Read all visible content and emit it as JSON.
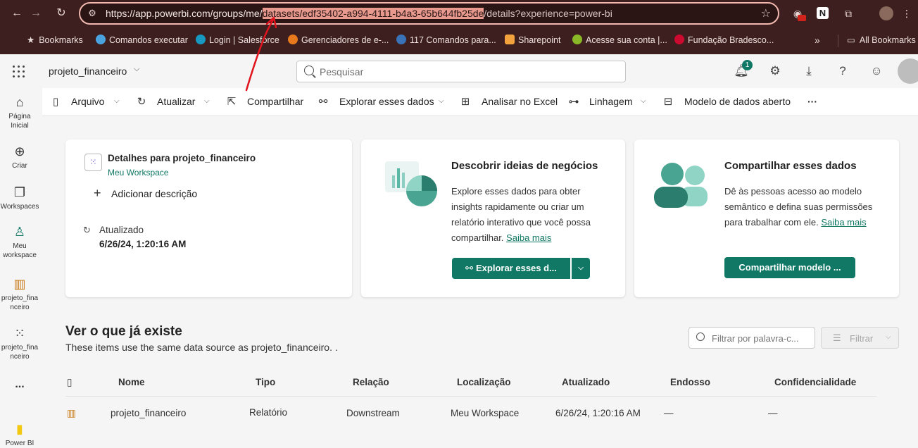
{
  "browser": {
    "url_prefix": "https://app.powerbi.com/groups/me/",
    "url_highlight": "datasets/edf35402-a994-4111-b4a3-65b644fb25de",
    "url_suffix": "/details?experience=power-bi",
    "bookmarks": [
      {
        "label": "Bookmarks",
        "icon": "star-icon",
        "color": "#d9c7c5"
      },
      {
        "label": "Comandos executar",
        "icon": "refresh-icon",
        "color": "#4aa3df"
      },
      {
        "label": "Login | Salesforce",
        "icon": "cloud-icon",
        "color": "#1798c1"
      },
      {
        "label": "Gerenciadores de e-...",
        "icon": "firefox-icon",
        "color": "#e8791c"
      },
      {
        "label": "117 Comandos para...",
        "icon": "globe-icon",
        "color": "#3b73b9"
      },
      {
        "label": "Sharepoint",
        "icon": "grid-icon",
        "color": "#f2a33c"
      },
      {
        "label": "Acesse sua conta |...",
        "icon": "dollar-icon",
        "color": "#8ab826"
      },
      {
        "label": "Fundação Bradesco...",
        "icon": "bradesco-icon",
        "color": "#cc092f"
      }
    ],
    "all_bookmarks": "All Bookmarks"
  },
  "header": {
    "workspace": "projeto_financeiro",
    "search_placeholder": "Pesquisar",
    "notification_count": "1"
  },
  "leftnav": [
    {
      "label1": "Página",
      "label2": "Inicial",
      "icon": "home-icon"
    },
    {
      "label1": "Criar",
      "label2": "",
      "icon": "create-icon"
    },
    {
      "label1": "Workspaces",
      "label2": "",
      "icon": "workspaces-icon"
    },
    {
      "label1": "Meu",
      "label2": "workspace",
      "icon": "my-workspace-icon"
    },
    {
      "label1": "projeto_fina",
      "label2": "nceiro",
      "icon": "report-icon"
    },
    {
      "label1": "projeto_fina",
      "label2": "nceiro",
      "icon": "semantic-model-icon"
    },
    {
      "label1": "...",
      "label2": "",
      "icon": "more-icon"
    },
    {
      "label1": "Power BI",
      "label2": "",
      "icon": "powerbi-logo-icon"
    }
  ],
  "toolbar": {
    "arquivo": "Arquivo",
    "atualizar": "Atualizar",
    "compartilhar": "Compartilhar",
    "explorar": "Explorar esses dados",
    "analisar": "Analisar no Excel",
    "linhagem": "Linhagem",
    "modelo": "Modelo de dados aberto",
    "more": "···"
  },
  "details_card": {
    "title": "Detalhes para projeto_financeiro",
    "workspace": "Meu Workspace",
    "add_description": "Adicionar descrição",
    "updated_label": "Atualizado",
    "updated_value": "6/26/24, 1:20:16 AM"
  },
  "insights_card": {
    "title": "Descobrir ideias de negócios",
    "text1": "Explore esses dados para obter",
    "text2": "insights rapidamente ou criar um",
    "text3": "relatório interativo que você possa",
    "text4": "compartilhar.",
    "link": "Saiba mais",
    "button": "Explorar esses d..."
  },
  "share_card": {
    "title": "Compartilhar esses dados",
    "text1": "Dê às pessoas acesso ao modelo",
    "text2": "semântico e defina suas permissões",
    "text3": "para trabalhar com ele.",
    "link": "Saiba mais",
    "button": "Compartilhar modelo ..."
  },
  "existing": {
    "title": "Ver o que já existe",
    "subtitle": "These items use the same data source as projeto_financeiro. .",
    "filter_placeholder": "Filtrar por palavra-c...",
    "filter_button": "Filtrar",
    "columns": [
      "Nome",
      "Tipo",
      "Relação",
      "Localização",
      "Atualizado",
      "Endosso",
      "Confidencialidade"
    ],
    "rows": [
      {
        "nome": "projeto_financeiro",
        "tipo": "Relatório",
        "relacao": "Downstream",
        "localizacao": "Meu Workspace",
        "atualizado": "6/26/24, 1:20:16 AM",
        "endosso": "—",
        "confidencialidade": "—"
      }
    ]
  },
  "colors": {
    "accent": "#117865",
    "chrome": "#3c1f1e",
    "highlight": "#e99a8f",
    "annotation": "#e0141e"
  }
}
